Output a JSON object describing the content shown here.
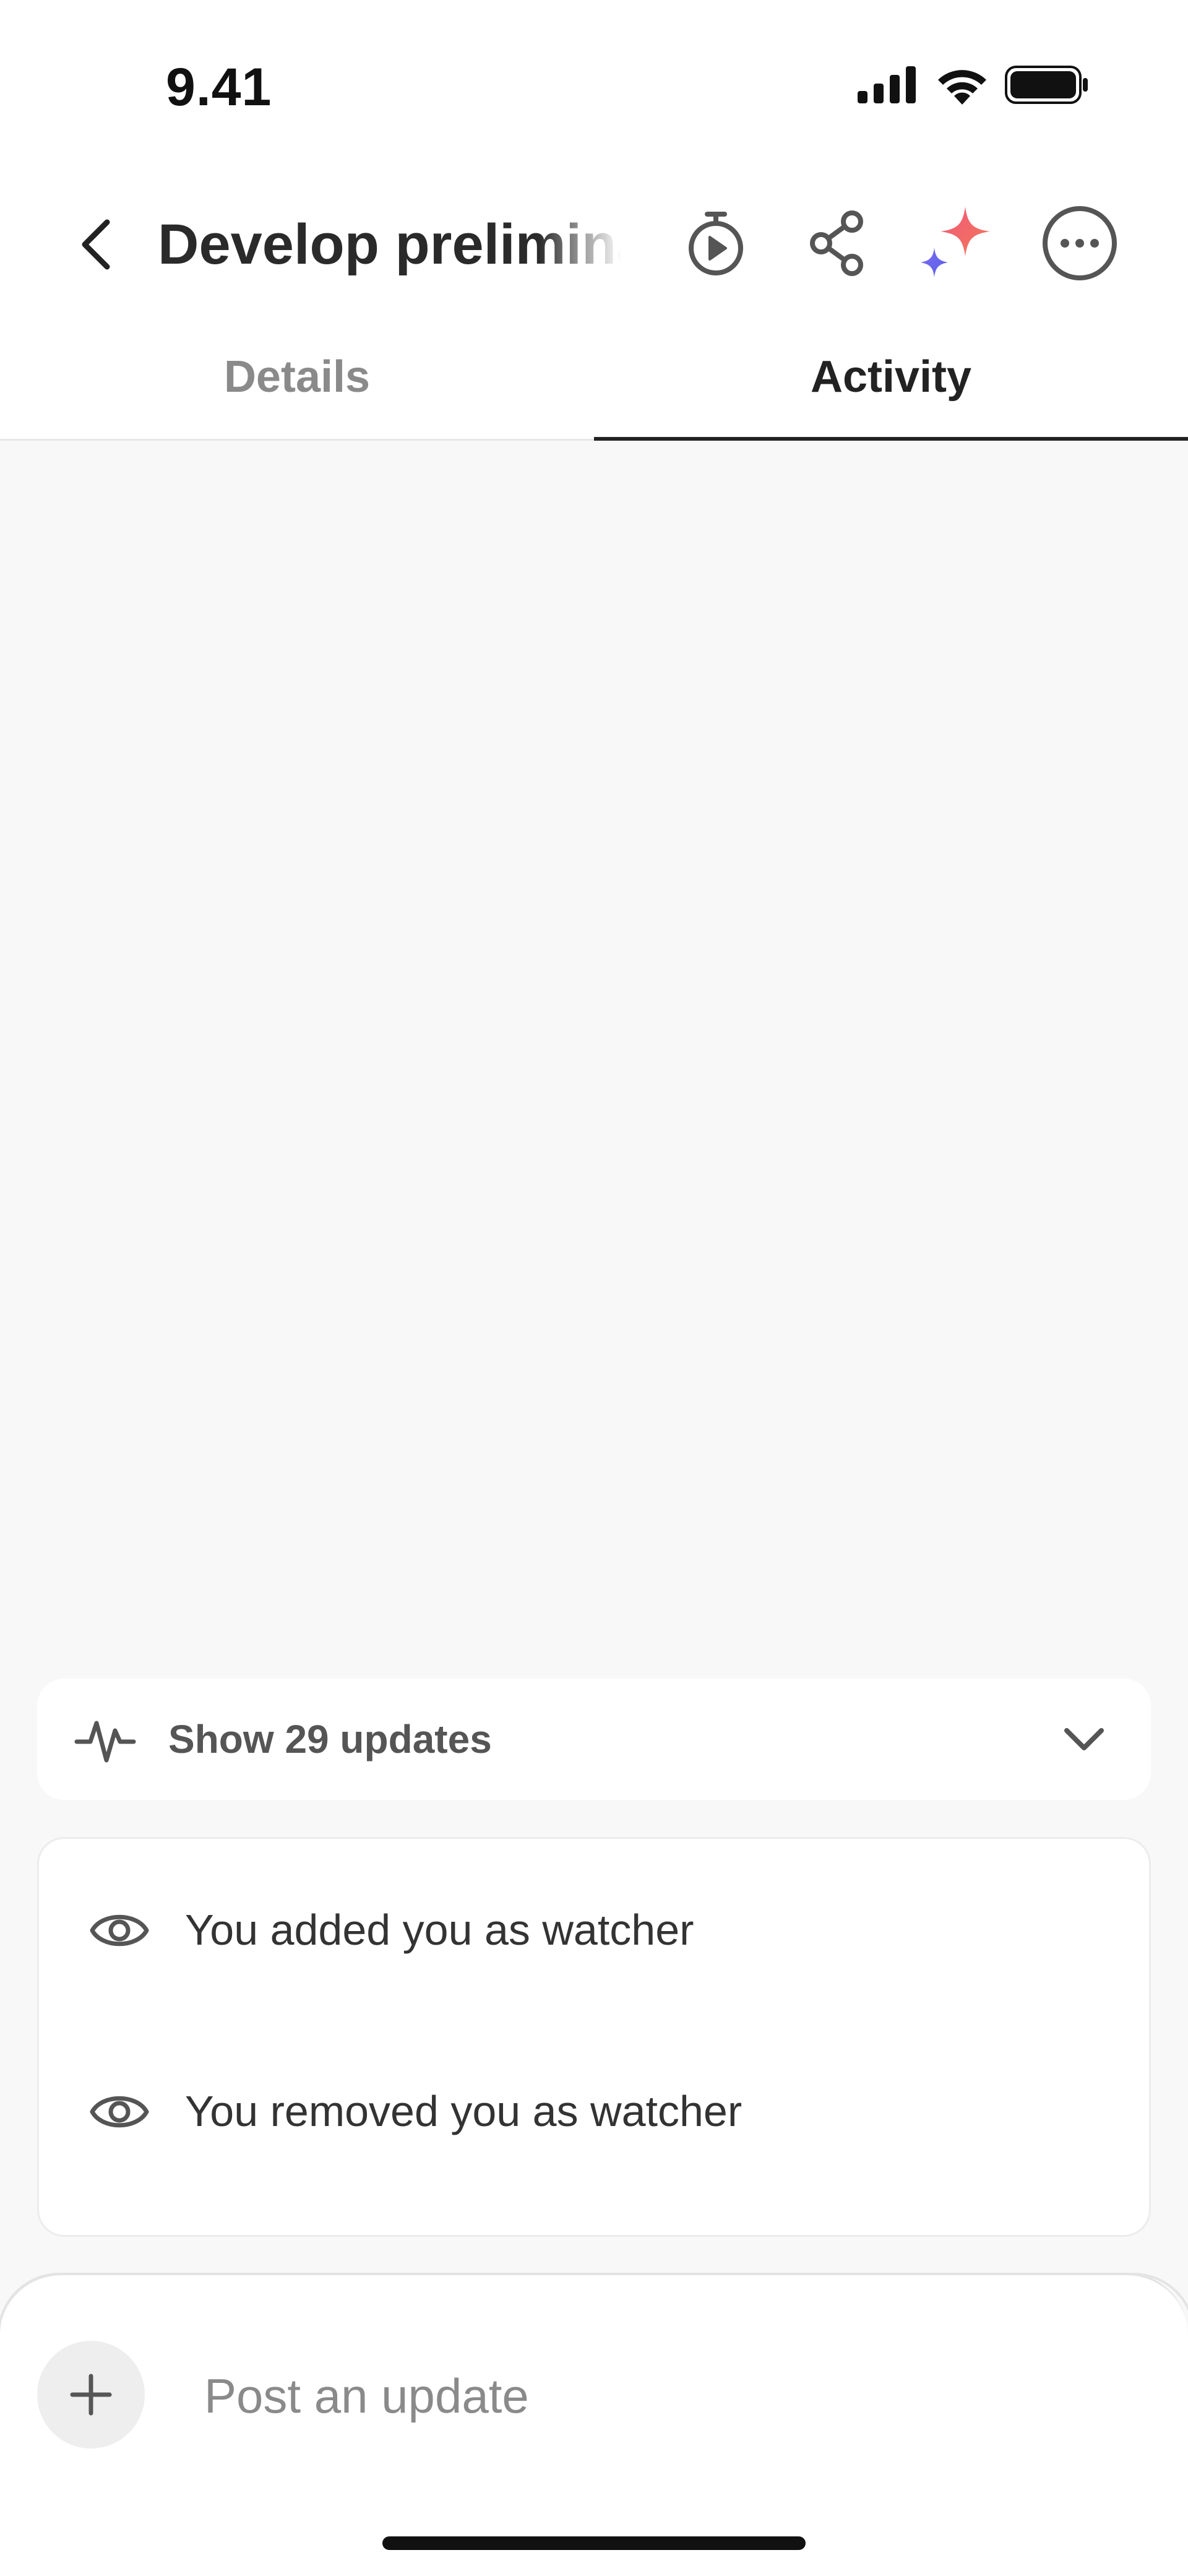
{
  "status_bar": {
    "time": "9.41",
    "icons": [
      "cellular-signal-icon",
      "wifi-icon",
      "battery-icon"
    ]
  },
  "header": {
    "title": "Develop preliminary",
    "icons": [
      "back-icon",
      "timer-play-icon",
      "share-icon",
      "ai-sparkle-icon",
      "more-options-icon"
    ]
  },
  "tabs": [
    {
      "label": "Details",
      "active": false
    },
    {
      "label": "Activity",
      "active": true
    }
  ],
  "updates": {
    "label": "Show 29 updates",
    "icon": "activity-pulse-icon",
    "toggle_icon": "chevron-down-icon"
  },
  "activity": {
    "items": [
      {
        "icon": "eye-icon",
        "text": "You added you as watcher"
      },
      {
        "icon": "eye-icon",
        "text": "You removed you as watcher"
      }
    ]
  },
  "composer": {
    "placeholder": "Post an update",
    "add_icon": "plus-icon"
  },
  "colors": {
    "background": "#f8f8f8",
    "card": "#ffffff",
    "text_primary": "#222222",
    "text_muted": "#8a8a8a",
    "sparkle_pink": "#f0567a",
    "sparkle_blue": "#6b6cf2"
  }
}
